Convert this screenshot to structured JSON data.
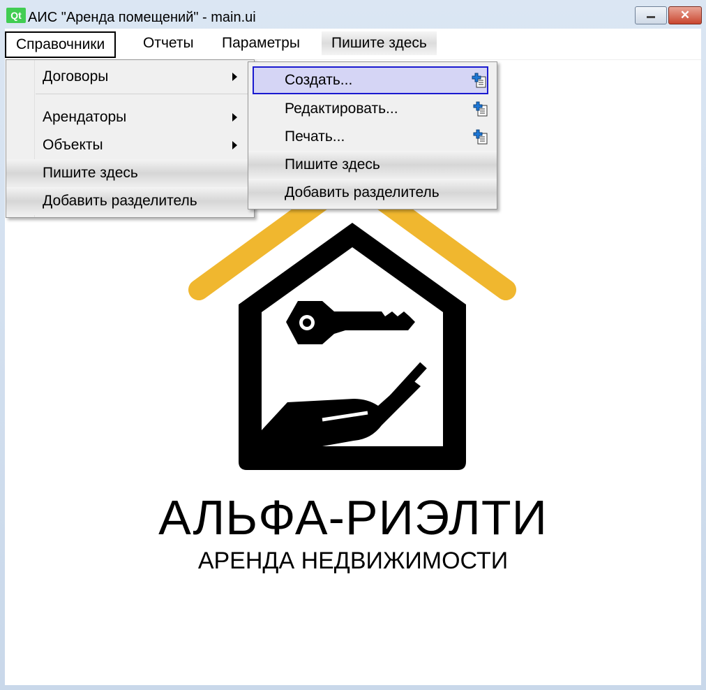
{
  "window": {
    "icon_text": "Qt",
    "title": "АИС \"Аренда помещений\" - main.ui",
    "close_glyph": "✕"
  },
  "menubar": {
    "items": [
      "Справочники",
      "Отчеты",
      "Параметры",
      "Пишите здесь"
    ]
  },
  "menu_reference": {
    "items": [
      "Договоры",
      "Арендаторы",
      "Объекты",
      "Пишите здесь",
      "Добавить разделитель"
    ]
  },
  "menu_contracts": {
    "items": [
      "Создать...",
      "Редактировать...",
      "Печать...",
      "Пишите здесь",
      "Добавить разделитель"
    ],
    "icon": "new-document-icon"
  },
  "logo": {
    "title": "АЛЬФА-РИЭЛТИ",
    "subtitle": "АРЕНДА НЕДВИЖИМОСТИ",
    "partial_text": "!",
    "colors": {
      "roof": "#f0b72f",
      "house": "#000000"
    }
  }
}
